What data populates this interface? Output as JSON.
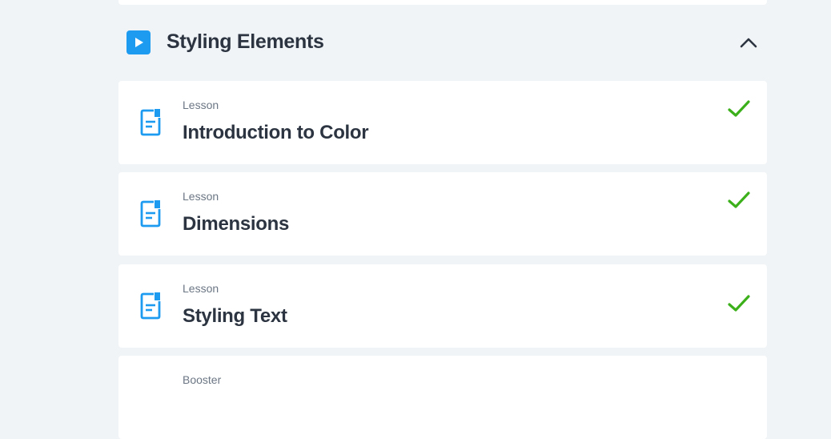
{
  "colors": {
    "background": "#f1f4f7",
    "accent": "#1d9bf0",
    "complete": "#3cb01a",
    "text": "#2b3440",
    "muted": "#6b7684"
  },
  "section": {
    "title": "Styling Elements",
    "icon": "play-icon",
    "toggle_icon": "chevron-up-icon"
  },
  "items": [
    {
      "kind": "Lesson",
      "title": "Introduction to Color",
      "icon": "lesson-document-icon",
      "status_icon": "checkmark-icon"
    },
    {
      "kind": "Lesson",
      "title": "Dimensions",
      "icon": "lesson-document-icon",
      "status_icon": "checkmark-icon"
    },
    {
      "kind": "Lesson",
      "title": "Styling Text",
      "icon": "lesson-document-icon",
      "status_icon": "checkmark-icon"
    },
    {
      "kind": "Booster"
    }
  ]
}
